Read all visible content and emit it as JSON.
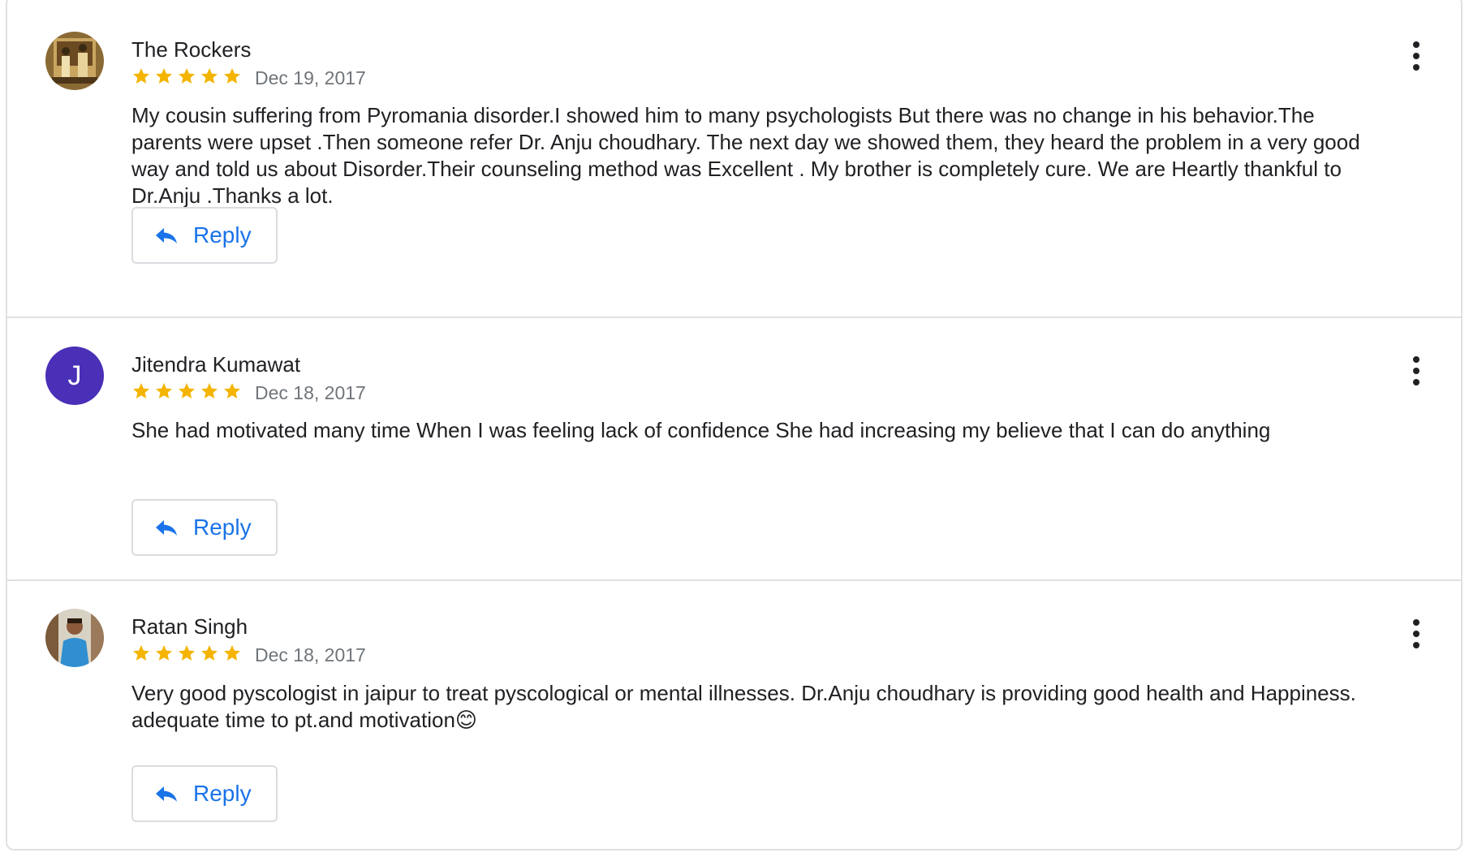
{
  "colors": {
    "star": "#f4b400",
    "reply_text": "#1a73e8",
    "letter_avatar_bg": "#4a2fb7",
    "divider": "#e0e0e0"
  },
  "reviews": [
    {
      "reviewer": "The Rockers",
      "avatar_type": "photo",
      "rating": 5,
      "date": "Dec 19, 2017",
      "text": "My cousin suffering from Pyromania disorder.I showed him to many psychologists But there was no change in his behavior.The parents were upset .Then someone refer Dr. Anju choudhary. The next day we showed them, they heard the problem in a very good way and told us about Disorder.Their counseling method was Excellent . My brother is completely cure. We are Heartly thankful to Dr.Anju .Thanks a lot.",
      "reply_label": "Reply"
    },
    {
      "reviewer": "Jitendra Kumawat",
      "avatar_type": "letter",
      "avatar_letter": "J",
      "rating": 5,
      "date": "Dec 18, 2017",
      "text": "She had motivated many time When I was feeling lack of confidence She had increasing my believe that I can do anything",
      "reply_label": "Reply"
    },
    {
      "reviewer": "Ratan Singh",
      "avatar_type": "photo",
      "rating": 5,
      "date": "Dec 18, 2017",
      "text": "Very good pyscologist in jaipur to treat pyscological or mental illnesses. Dr.Anju choudhary is providing good health and Happiness. adequate time to pt.and motivation😊",
      "reply_label": "Reply"
    }
  ]
}
